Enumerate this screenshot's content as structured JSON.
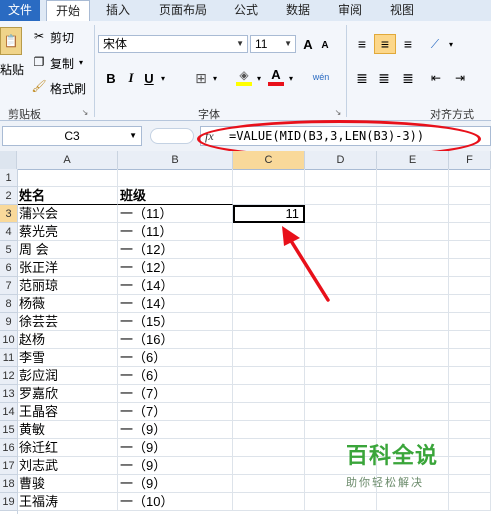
{
  "ribbon": {
    "tabs": [
      "文件",
      "开始",
      "插入",
      "页面布局",
      "公式",
      "数据",
      "审阅",
      "视图"
    ],
    "clipboard": {
      "paste": "粘贴",
      "cut": "剪切",
      "copy": "复制",
      "format_painter": "格式刷",
      "group": "剪贴板"
    },
    "font": {
      "name": "宋体",
      "size": "11",
      "group": "字体",
      "bold": "B",
      "italic": "I",
      "underline": "U",
      "grow": "A",
      "shrink": "A",
      "phonetic": "wén"
    },
    "alignment": {
      "group": "对齐方式"
    }
  },
  "formula_bar": {
    "name_box": "C3",
    "fx": "fx",
    "formula": "=VALUE(MID(B3,3,LEN(B3)-3))"
  },
  "columns": [
    "A",
    "B",
    "C",
    "D",
    "E",
    "F"
  ],
  "rows": [
    {
      "n": "1",
      "a": "",
      "b": ""
    },
    {
      "n": "2",
      "a": "姓名",
      "b": "班级"
    },
    {
      "n": "3",
      "a": "蒲兴会",
      "b": "一（11）",
      "c": "11"
    },
    {
      "n": "4",
      "a": "蔡光亮",
      "b": "一（11）"
    },
    {
      "n": "5",
      "a": "周 会",
      "b": "一（12）"
    },
    {
      "n": "6",
      "a": "张正洋",
      "b": "一（12）"
    },
    {
      "n": "7",
      "a": "范丽琼",
      "b": "一（14）"
    },
    {
      "n": "8",
      "a": "杨薇",
      "b": "一（14）"
    },
    {
      "n": "9",
      "a": "徐芸芸",
      "b": "一（15）"
    },
    {
      "n": "10",
      "a": "赵杨",
      "b": "一（16）"
    },
    {
      "n": "11",
      "a": "李雪",
      "b": "一（6）"
    },
    {
      "n": "12",
      "a": "彭应润",
      "b": "一（6）"
    },
    {
      "n": "13",
      "a": "罗嘉欣",
      "b": "一（7）"
    },
    {
      "n": "14",
      "a": "王晶容",
      "b": "一（7）"
    },
    {
      "n": "15",
      "a": "黄敏",
      "b": "一（9）"
    },
    {
      "n": "16",
      "a": "徐迁红",
      "b": "一（9）"
    },
    {
      "n": "17",
      "a": "刘志武",
      "b": "一（9）"
    },
    {
      "n": "18",
      "a": "曹骏",
      "b": "一（9）"
    },
    {
      "n": "19",
      "a": "王福涛",
      "b": "一（10）"
    }
  ],
  "watermark": {
    "title": "百科全说",
    "subtitle": "助你轻松解决"
  },
  "colors": {
    "accent": "#e8101a",
    "file_tab": "#2a6bc2",
    "watermark": "#3aa53a"
  }
}
